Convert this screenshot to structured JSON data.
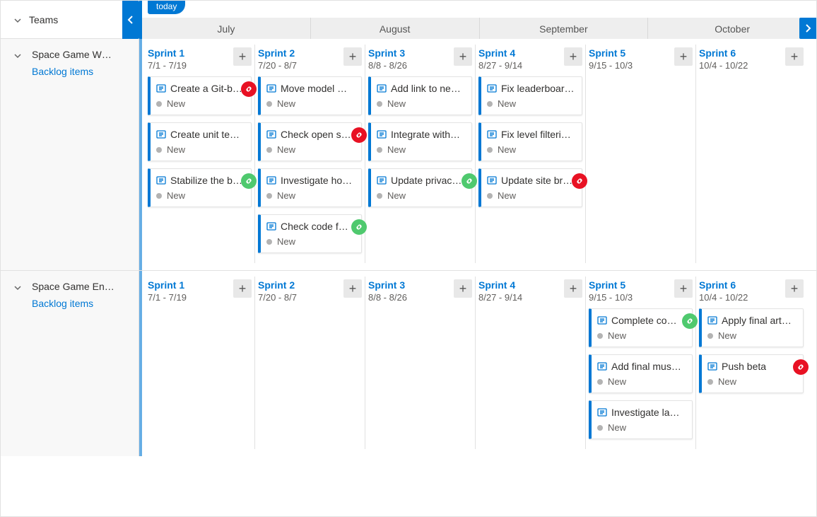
{
  "header": {
    "teams_label": "Teams",
    "today_label": "today",
    "months": [
      "July",
      "August",
      "September",
      "October"
    ]
  },
  "state_new": "New",
  "backlog_label": "Backlog items",
  "teams": [
    {
      "name": "Space Game W…",
      "sprints": [
        {
          "title": "Sprint 1",
          "dates": "7/1 - 7/19",
          "cards": [
            {
              "title": "Create a Git-b…",
              "badge": "red"
            },
            {
              "title": "Create unit te…",
              "badge": null
            },
            {
              "title": "Stabilize the b…",
              "badge": "green"
            }
          ]
        },
        {
          "title": "Sprint 2",
          "dates": "7/20 - 8/7",
          "cards": [
            {
              "title": "Move model …",
              "badge": null
            },
            {
              "title": "Check open s…",
              "badge": "red"
            },
            {
              "title": "Investigate ho…",
              "badge": null
            },
            {
              "title": "Check code f…",
              "badge": "green"
            }
          ]
        },
        {
          "title": "Sprint 3",
          "dates": "8/8 - 8/26",
          "cards": [
            {
              "title": "Add link to ne…",
              "badge": null
            },
            {
              "title": "Integrate with…",
              "badge": null
            },
            {
              "title": "Update privac…",
              "badge": "green"
            }
          ]
        },
        {
          "title": "Sprint 4",
          "dates": "8/27 - 9/14",
          "cards": [
            {
              "title": "Fix leaderboar…",
              "badge": null
            },
            {
              "title": "Fix level filteri…",
              "badge": null
            },
            {
              "title": "Update site br…",
              "badge": "red"
            }
          ]
        },
        {
          "title": "Sprint 5",
          "dates": "9/15 - 10/3",
          "cards": []
        },
        {
          "title": "Sprint 6",
          "dates": "10/4 - 10/22",
          "cards": []
        }
      ]
    },
    {
      "name": "Space Game En…",
      "sprints": [
        {
          "title": "Sprint 1",
          "dates": "7/1 - 7/19",
          "cards": []
        },
        {
          "title": "Sprint 2",
          "dates": "7/20 - 8/7",
          "cards": []
        },
        {
          "title": "Sprint 3",
          "dates": "8/8 - 8/26",
          "cards": []
        },
        {
          "title": "Sprint 4",
          "dates": "8/27 - 9/14",
          "cards": []
        },
        {
          "title": "Sprint 5",
          "dates": "9/15 - 10/3",
          "cards": [
            {
              "title": "Complete co…",
              "badge": "green"
            },
            {
              "title": "Add final mus…",
              "badge": null
            },
            {
              "title": "Investigate la…",
              "badge": null
            }
          ]
        },
        {
          "title": "Sprint 6",
          "dates": "10/4 - 10/22",
          "cards": [
            {
              "title": "Apply final art…",
              "badge": null
            },
            {
              "title": "Push beta",
              "badge": "red"
            }
          ]
        }
      ]
    }
  ]
}
